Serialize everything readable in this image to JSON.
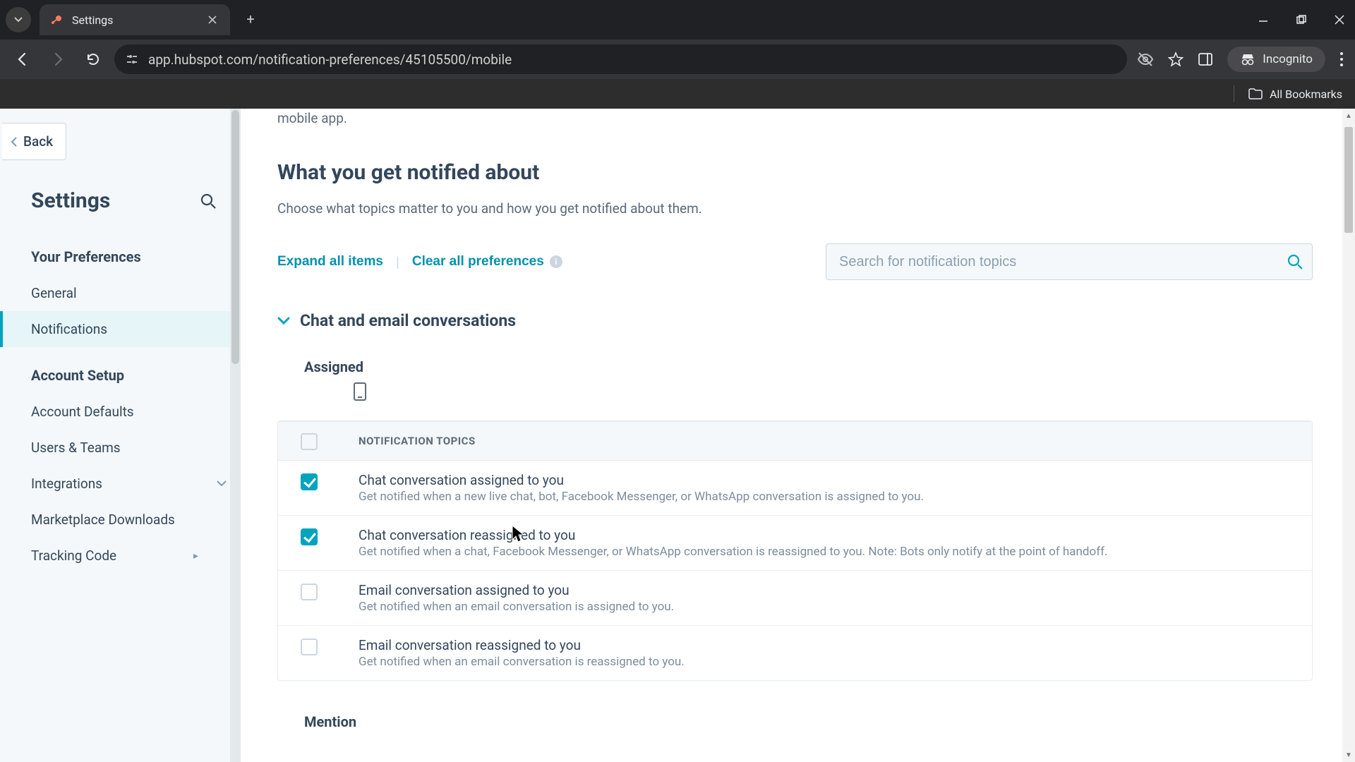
{
  "browser": {
    "tab_title": "Settings",
    "url": "app.hubspot.com/notification-preferences/45105500/mobile",
    "incognito_label": "Incognito",
    "all_bookmarks": "All Bookmarks"
  },
  "sidebar": {
    "back_label": "Back",
    "title": "Settings",
    "section1_title": "Your Preferences",
    "items1": [
      {
        "label": "General"
      },
      {
        "label": "Notifications"
      }
    ],
    "section2_title": "Account Setup",
    "items2": [
      {
        "label": "Account Defaults"
      },
      {
        "label": "Users & Teams"
      },
      {
        "label": "Integrations"
      },
      {
        "label": "Marketplace Downloads"
      },
      {
        "label": "Tracking Code"
      }
    ]
  },
  "main": {
    "lead_fragment": "mobile app.",
    "heading": "What you get notified about",
    "subheading": "Choose what topics matter to you and how you get notified about them.",
    "expand_label": "Expand all items",
    "clear_label": "Clear all preferences",
    "search_placeholder": "Search for notification topics",
    "collapse_title": "Chat and email conversations",
    "assigned_label": "Assigned",
    "th_topics": "NOTIFICATION TOPICS",
    "rows": [
      {
        "title": "Chat conversation assigned to you",
        "desc": "Get notified when a new live chat, bot, Facebook Messenger, or WhatsApp conversation is assigned to you.",
        "checked": true
      },
      {
        "title": "Chat conversation reassigned to you",
        "desc": "Get notified when a chat, Facebook Messenger, or WhatsApp conversation is reassigned to you. Note: Bots only notify at the point of handoff.",
        "checked": true
      },
      {
        "title": "Email conversation assigned to you",
        "desc": "Get notified when an email conversation is assigned to you.",
        "checked": false
      },
      {
        "title": "Email conversation reassigned to you",
        "desc": "Get notified when an email conversation is reassigned to you.",
        "checked": false
      }
    ],
    "mention_label": "Mention"
  }
}
